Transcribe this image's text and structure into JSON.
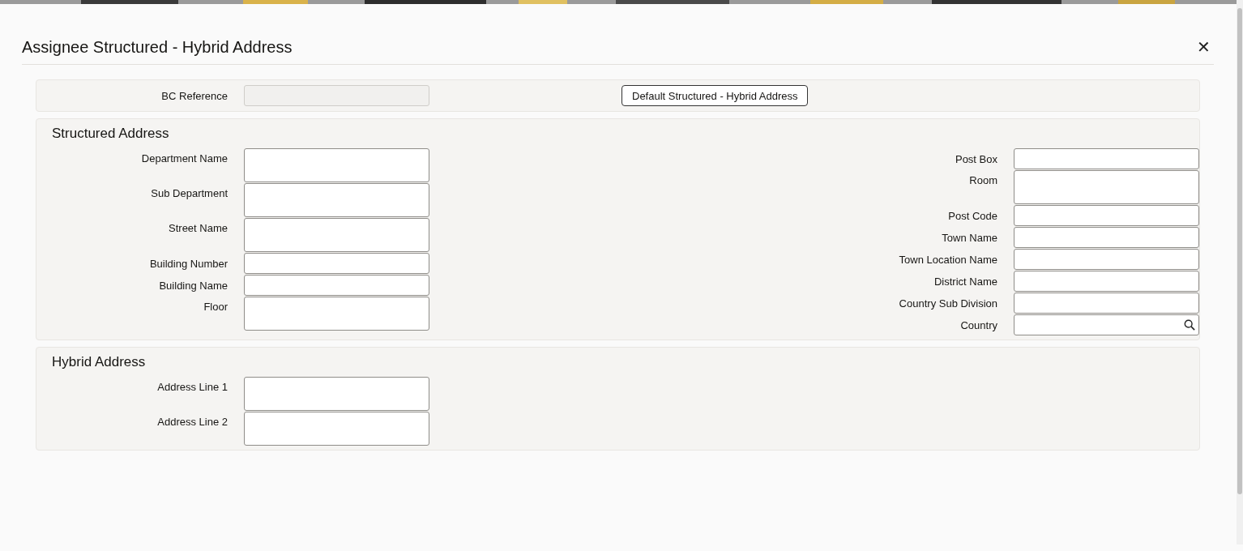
{
  "window": {
    "title": "Assignee Structured - Hybrid Address",
    "close": "✕"
  },
  "reference": {
    "label": "BC Reference",
    "disabled": true,
    "button": "Default Structured - Hybrid Address"
  },
  "structured": {
    "title": "Structured Address",
    "left": [
      {
        "label": "Department Name",
        "kind": "textarea"
      },
      {
        "label": "Sub Department",
        "kind": "textarea"
      },
      {
        "label": "Street Name",
        "kind": "textarea"
      },
      {
        "label": "Building Number",
        "kind": "text"
      },
      {
        "label": "Building Name",
        "kind": "text"
      },
      {
        "label": "Floor",
        "kind": "textarea"
      }
    ],
    "right": [
      {
        "label": "Post Box",
        "kind": "text"
      },
      {
        "label": "Room",
        "kind": "textarea"
      },
      {
        "label": "Post Code",
        "kind": "text"
      },
      {
        "label": "Town Name",
        "kind": "text"
      },
      {
        "label": "Town Location Name",
        "kind": "text"
      },
      {
        "label": "District Name",
        "kind": "text"
      },
      {
        "label": "Country Sub Division",
        "kind": "text"
      },
      {
        "label": "Country",
        "kind": "lookup"
      }
    ]
  },
  "hybrid": {
    "title": "Hybrid Address",
    "left": [
      {
        "label": "Address Line 1",
        "kind": "textarea"
      },
      {
        "label": "Address Line 2",
        "kind": "textarea"
      }
    ]
  }
}
